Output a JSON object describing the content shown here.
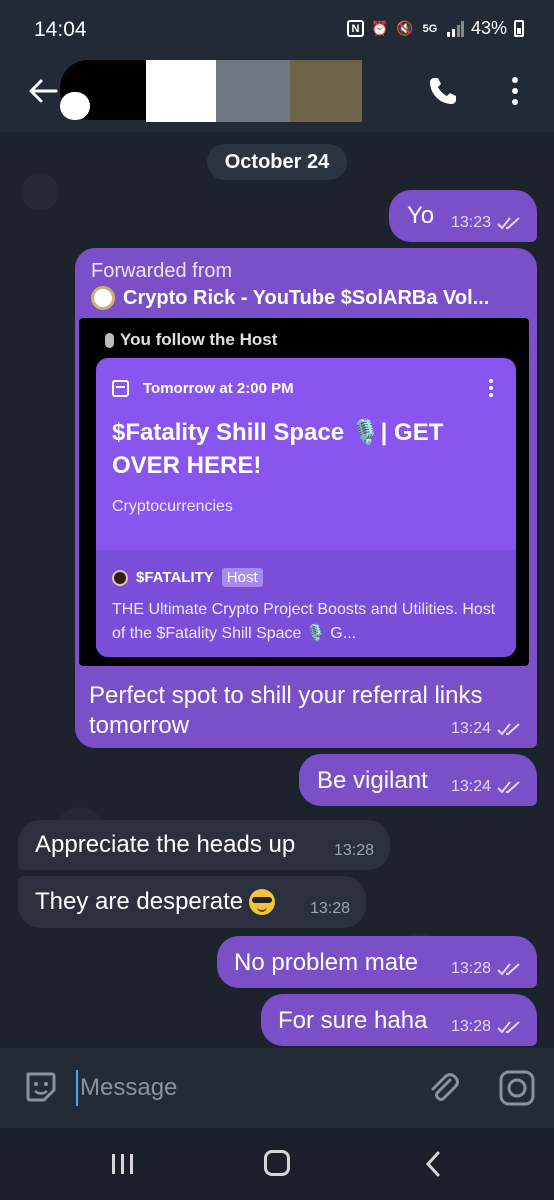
{
  "status_bar": {
    "time": "14:04",
    "network": "5G",
    "battery": "43%"
  },
  "app_bar": {
    "icons": [
      "back-arrow-icon",
      "phone-icon",
      "more-vertical-icon"
    ]
  },
  "chat": {
    "date_separator": "October 24",
    "messages": [
      {
        "id": "yo",
        "direction": "outgoing",
        "text": "Yo",
        "time": "13:23",
        "status": "read"
      },
      {
        "id": "forwarded",
        "direction": "outgoing",
        "forwarded_label": "Forwarded from",
        "forwarded_source": "Crypto Rick - YouTube $SolARBa Vol...",
        "image": {
          "follow_label": "You follow the Host",
          "card": {
            "when": "Tomorrow at 2:00 PM",
            "title": "$Fatality Shill Space 🎙️| GET OVER HERE!",
            "category": "Cryptocurrencies",
            "host_name": "$FATALITY",
            "host_badge": "Host",
            "host_description": "THE Ultimate Crypto Project Boosts and Utilities. Host of the $Fatality Shill Space 🎙️ G..."
          }
        },
        "text": "Perfect spot to shill your referral links tomorrow",
        "time": "13:24",
        "status": "read"
      },
      {
        "id": "vigilant",
        "direction": "outgoing",
        "text": "Be vigilant",
        "time": "13:24",
        "status": "read"
      },
      {
        "id": "appreciate",
        "direction": "incoming",
        "text": "Appreciate the heads up",
        "time": "13:28"
      },
      {
        "id": "desperate",
        "direction": "incoming",
        "text": "They are desperate",
        "emoji": "😎",
        "time": "13:28"
      },
      {
        "id": "noproblem",
        "direction": "outgoing",
        "text": "No problem mate",
        "time": "13:28",
        "status": "read"
      },
      {
        "id": "forsure",
        "direction": "outgoing",
        "text": "For sure haha",
        "time": "13:28",
        "status": "read"
      }
    ]
  },
  "composer": {
    "placeholder": "Message",
    "value": ""
  },
  "colors": {
    "outgoing_bubble": "#7b4fc7",
    "incoming_bubble": "#2a313c",
    "card_purple": "#8855f0",
    "background": "#1c232d",
    "header": "#222a35"
  }
}
